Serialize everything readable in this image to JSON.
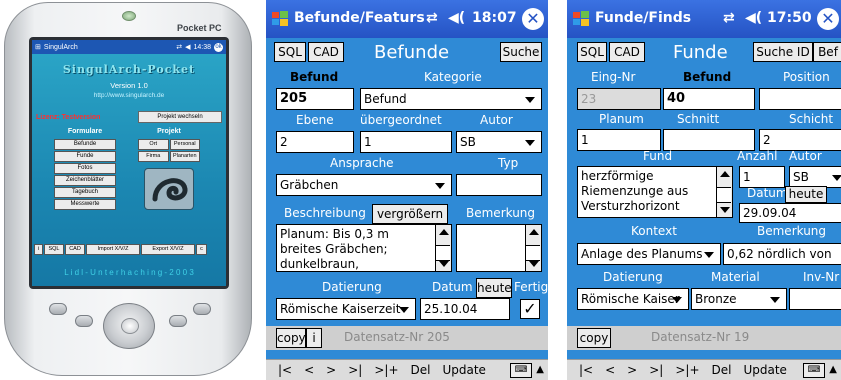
{
  "device": {
    "brand": "Pocket PC",
    "mini_screen": {
      "title": "SingulArch",
      "time": "14:38",
      "app_title": "SingulArch-Pocket",
      "version": "Version 1.0",
      "url": "http://www.singularch.de",
      "licence": "Lizenz: Testversion",
      "switch_project": "Projekt wechseln",
      "forms_heading": "Formulare",
      "project_heading": "Projekt",
      "forms": [
        "Befunde",
        "Funde",
        "Fotos",
        "Zeichenblätter",
        "Tagebuch",
        "Messwerte"
      ],
      "project_buttons": [
        "Ort",
        "Personal",
        "Firma",
        "Planarten"
      ],
      "bottom_buttons": [
        "i",
        "SQL",
        "CAD",
        "Import X/V/Z",
        "Export X/V/Z",
        "c"
      ],
      "footer": "L i d l - U n t e r h a c h i n g - 2 0 0 3"
    }
  },
  "befunde": {
    "window_title": "Befunde/Featurs",
    "time": "18:07",
    "sql": "SQL",
    "cad": "CAD",
    "heading": "Befunde",
    "search": "Suche",
    "lbl_befund": "Befund",
    "lbl_kategorie": "Kategorie",
    "befund_value": "205",
    "kategorie_value": "Befund",
    "lbl_ebene": "Ebene",
    "lbl_uebergeordnet": "übergeordnet",
    "lbl_autor": "Autor",
    "ebene_value": "2",
    "uebergeordnet_value": "1",
    "autor_value": "SB",
    "lbl_ansprache": "Ansprache",
    "lbl_typ": "Typ",
    "ansprache_value": "Gräbchen",
    "typ_value": "",
    "lbl_beschreibung": "Beschreibung",
    "enlarge": "vergrößern",
    "lbl_bemerkung": "Bemerkung",
    "beschreibung_value": "Planum: Bis 0,3 m breites Gräbchen; dunkelbraun,",
    "lbl_datierung": "Datierung",
    "lbl_datum": "Datum",
    "today": "heute",
    "lbl_fertig": "Fertig",
    "datierung_value": "Römische Kaiserzeit",
    "datum_value": "25.10.04",
    "copy": "copy",
    "info": "i",
    "record": "Datensatz-Nr 205",
    "nav": [
      "|<",
      "<",
      ">",
      ">|",
      ">|+",
      "Del",
      "Update"
    ]
  },
  "funde": {
    "window_title": "Funde/Finds",
    "time": "17:50",
    "sql": "SQL",
    "cad": "CAD",
    "heading": "Funde",
    "search_id": "Suche ID",
    "bef": "Bef",
    "lbl_eingnr": "Eing-Nr",
    "lbl_befund": "Befund",
    "lbl_position": "Position",
    "eingnr_value": "23",
    "befund_value": "40",
    "position_value": "",
    "lbl_planum": "Planum",
    "lbl_schnitt": "Schnitt",
    "lbl_schicht": "Schicht",
    "planum_value": "1",
    "schnitt_value": "",
    "schicht_value": "2",
    "lbl_fund": "Fund",
    "lbl_anzahl": "Anzahl",
    "lbl_autor": "Autor",
    "fund_value": "herzförmige Riemenzunge aus Versturzhorizont",
    "anzahl_value": "1",
    "autor_value": "SB",
    "lbl_datum": "Datum",
    "today": "heute",
    "datum_value": "29.09.04",
    "lbl_kontext": "Kontext",
    "lbl_bemerkung": "Bemerkung",
    "kontext_value": "Anlage des Planums",
    "bemerkung_value": "0,62 nördlich von",
    "lbl_datierung": "Datierung",
    "lbl_material": "Material",
    "lbl_invnr": "Inv-Nr",
    "datierung_value": "Römische Kaiser",
    "material_value": "Bronze",
    "invnr_value": "",
    "copy": "copy",
    "record": "Datensatz-Nr 19",
    "nav": [
      "|<",
      "<",
      ">",
      ">|",
      ">|+",
      "Del",
      "Update"
    ]
  }
}
